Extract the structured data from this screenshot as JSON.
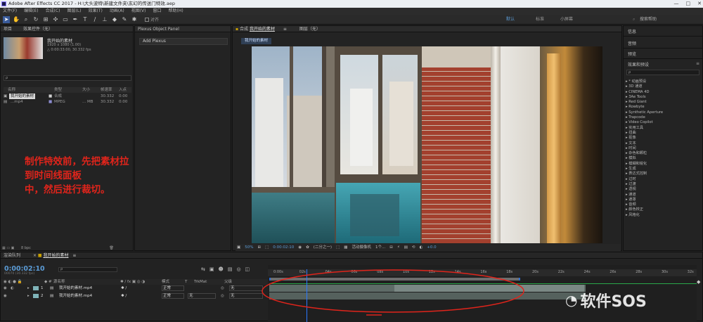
{
  "window": {
    "title": "Adobe After Effects CC 2017 - H:\\大头波特\\新建文件夹\\玄幻的传送门特效.aep",
    "min": "—",
    "max": "□",
    "close": "✕"
  },
  "menu": [
    "文件(F)",
    "编辑(E)",
    "合成(C)",
    "图层(L)",
    "效果(T)",
    "动画(A)",
    "视图(V)",
    "窗口",
    "帮助(H)"
  ],
  "toolbar": {
    "snap_label": "对齐",
    "ws_default": "默认",
    "ws_standard": "标准",
    "ws_small": "小屏幕",
    "search_placeholder": "搜索帮助"
  },
  "project": {
    "tab": "项目",
    "effect_controls_tab": "效果控件（无）",
    "selected_name": "我开始的素材",
    "selected_info1": "1920 x 1080 (1.00)",
    "selected_info2": "△ 0:00:33:00, 30.332 fps",
    "search_placeholder": "ρ",
    "columns": [
      "名称",
      "类型",
      "大小",
      "帧速率",
      "入点"
    ],
    "items": [
      {
        "name": "我开始的素材",
        "type": "合成",
        "size": "",
        "fps": "30.332",
        "in": "0:00"
      },
      {
        "name": "...mp4",
        "type": "MPEG",
        "size": "... MB",
        "fps": "30.332",
        "in": "0:00"
      }
    ],
    "footer_bpc": "8 bpc"
  },
  "annotation": {
    "line1": "制作特效前，先把素材拉到时间线面板",
    "line2": "中，然后进行裁切。",
    "color": "#e0241b"
  },
  "plexus": {
    "tab": "Plexus Object Panel",
    "add_button": "Add Plexus"
  },
  "composition": {
    "tab_prefix": "合成",
    "tab_name": "我开始的素材",
    "layer_tab": "图层（无）",
    "subtab": "我开始的素材",
    "zoom": "50%",
    "timecode": "0:00:02:10",
    "resolution": "(二分之一)",
    "camera": "活动摄像机",
    "views": "1个...",
    "exposure": "+0.0"
  },
  "right_panels": {
    "info": "信息",
    "audio": "音频",
    "preview": "预览",
    "effects_title": "效果和预设",
    "search_placeholder": "ρ",
    "categories": [
      "* 动画预设",
      "3D 通道",
      "CINEMA 4D",
      "3Ae Tools",
      "Red Giant",
      "Rowbyte",
      "Synthetic Aperture",
      "Trapcode",
      "Video Copilot",
      "实用工具",
      "扭曲",
      "抠像",
      "文本",
      "时间",
      "杂色和颗粒",
      "模拟",
      "模糊和锐化",
      "生成",
      "表达式控制",
      "过时",
      "过渡",
      "透视",
      "通道",
      "遮罩",
      "音频",
      "颜色校正",
      "风格化"
    ]
  },
  "timeline": {
    "render_tab": "渲染队列",
    "comp_tab": "我开始的素材",
    "timecode": "0:00:02:10",
    "timecode_sub": "00070 (30.332 fps)",
    "columns": {
      "name": "源名称",
      "mode": "模式",
      "trkmat": "TrkMat",
      "parent": "父级"
    },
    "ruler": [
      "0:00s",
      "02s",
      "04s",
      "06s",
      "08s",
      "10s",
      "12s",
      "14s",
      "16s",
      "18s",
      "20s",
      "22s",
      "24s",
      "26s",
      "28s",
      "30s",
      "32s"
    ],
    "playhead_seconds": 2.33,
    "layers": [
      {
        "num": "1",
        "name": "我开始的素材.mp4",
        "mode": "正常",
        "trkmat": "",
        "parent": "无"
      },
      {
        "num": "2",
        "name": "我开始的素材.mp4",
        "mode": "正常",
        "trkmat": "无",
        "parent": "无"
      }
    ]
  },
  "watermark": {
    "text": "软件SOS"
  }
}
